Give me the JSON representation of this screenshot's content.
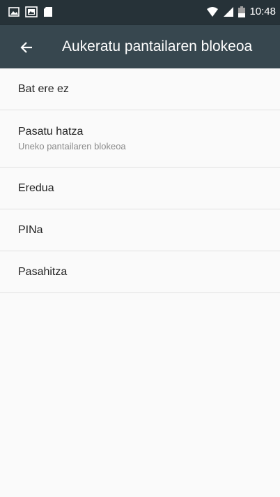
{
  "status_bar": {
    "time": "10:48",
    "left_icons": [
      "image-icon",
      "gallery-icon",
      "sd-card-icon"
    ],
    "right_icons": [
      "wifi-icon",
      "signal-icon",
      "battery-icon"
    ]
  },
  "app_bar": {
    "title": "Aukeratu pantailaren blokeoa",
    "back_icon": "arrow-back-icon"
  },
  "options": [
    {
      "label": "Bat ere ez"
    },
    {
      "label": "Pasatu hatza",
      "summary": "Uneko pantailaren blokeoa"
    },
    {
      "label": "Eredua"
    },
    {
      "label": "PINa"
    },
    {
      "label": "Pasahitza"
    }
  ],
  "colors": {
    "status_bar": "#263238",
    "app_bar": "#37474F",
    "background": "#FAFAFA",
    "divider": "#E2E2E2",
    "primary_text": "#212121",
    "secondary_text": "#8A8A8A"
  }
}
